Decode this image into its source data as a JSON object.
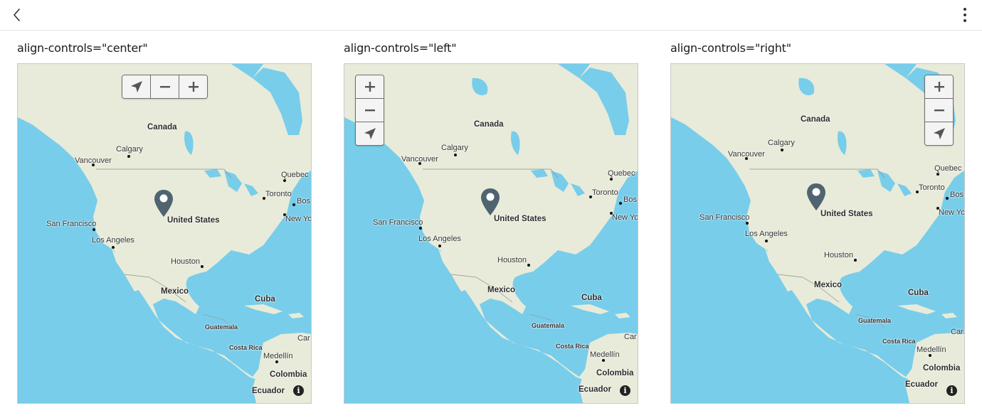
{
  "topbar": {
    "back_icon": "chevron-left-icon",
    "more_icon": "more-vertical-icon"
  },
  "panels": [
    {
      "title": "align-controls=\"center\"",
      "controls": [
        "locate",
        "zoom-out",
        "zoom-in"
      ],
      "orientation": "horizontal"
    },
    {
      "title": "align-controls=\"left\"",
      "controls": [
        "zoom-in",
        "zoom-out",
        "locate"
      ],
      "orientation": "vertical"
    },
    {
      "title": "align-controls=\"right\"",
      "controls": [
        "zoom-in",
        "zoom-out",
        "locate"
      ],
      "orientation": "vertical"
    }
  ],
  "map_labels": {
    "canada": "Canada",
    "calgary": "Calgary",
    "vancouver": "Vancouver",
    "quebec": "Quebec",
    "toronto": "Toronto",
    "boston": "Bos",
    "new_york": "New Yo",
    "united_states": "United States",
    "san_francisco": "San Francisco",
    "los_angeles": "Los Angeles",
    "houston": "Houston",
    "mexico": "Mexico",
    "cuba": "Cuba",
    "guatemala": "Guatemala",
    "costa_rica": "Costa Rica",
    "medellin": "Medellín",
    "colombia": "Colombia",
    "ecuador": "Ecuador",
    "caracas": "Car",
    "info": "i"
  },
  "colors": {
    "water": "#78cdea",
    "land": "#e8ebd9",
    "marker": "#4f6470",
    "control_border": "#6f6f6f",
    "control_bg": "#f4f4f4"
  }
}
